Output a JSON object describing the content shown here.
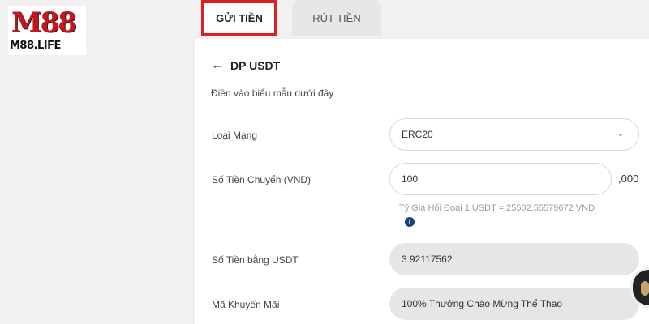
{
  "logo": {
    "top_text": "M88",
    "bottom_text": "M88.LIFE"
  },
  "tabs": [
    {
      "label": "GỬI TIỀN",
      "active": true,
      "highlight_color": "#e02020"
    },
    {
      "label": "RÚT TIỀN",
      "active": false
    }
  ],
  "form": {
    "title": "DP USDT",
    "subtitle": "Điền vào biểu mẫu dưới đây",
    "network": {
      "label": "Loại Mạng",
      "value": "ERC20"
    },
    "amount": {
      "label": "Số Tiền Chuyển (VND)",
      "value": "100",
      "suffix": ",000"
    },
    "rate_text": "Tỷ Giá Hối Đoái 1 USDT = 25502.55579672 VND",
    "usdt_amount": {
      "label": "Số Tiền bằng USDT",
      "value": "3.92117562"
    },
    "promo": {
      "label": "Mã Khuyến Mãi",
      "value": "100% Thưởng Chào Mừng Thể Thao"
    }
  },
  "icons": {
    "back": "arrow-left-icon",
    "dropdown": "chevron-down-icon",
    "info": "info-icon",
    "chat": "live-chat-icon"
  },
  "colors": {
    "accent_red": "#e02020",
    "info_blue": "#1d3f7a"
  }
}
